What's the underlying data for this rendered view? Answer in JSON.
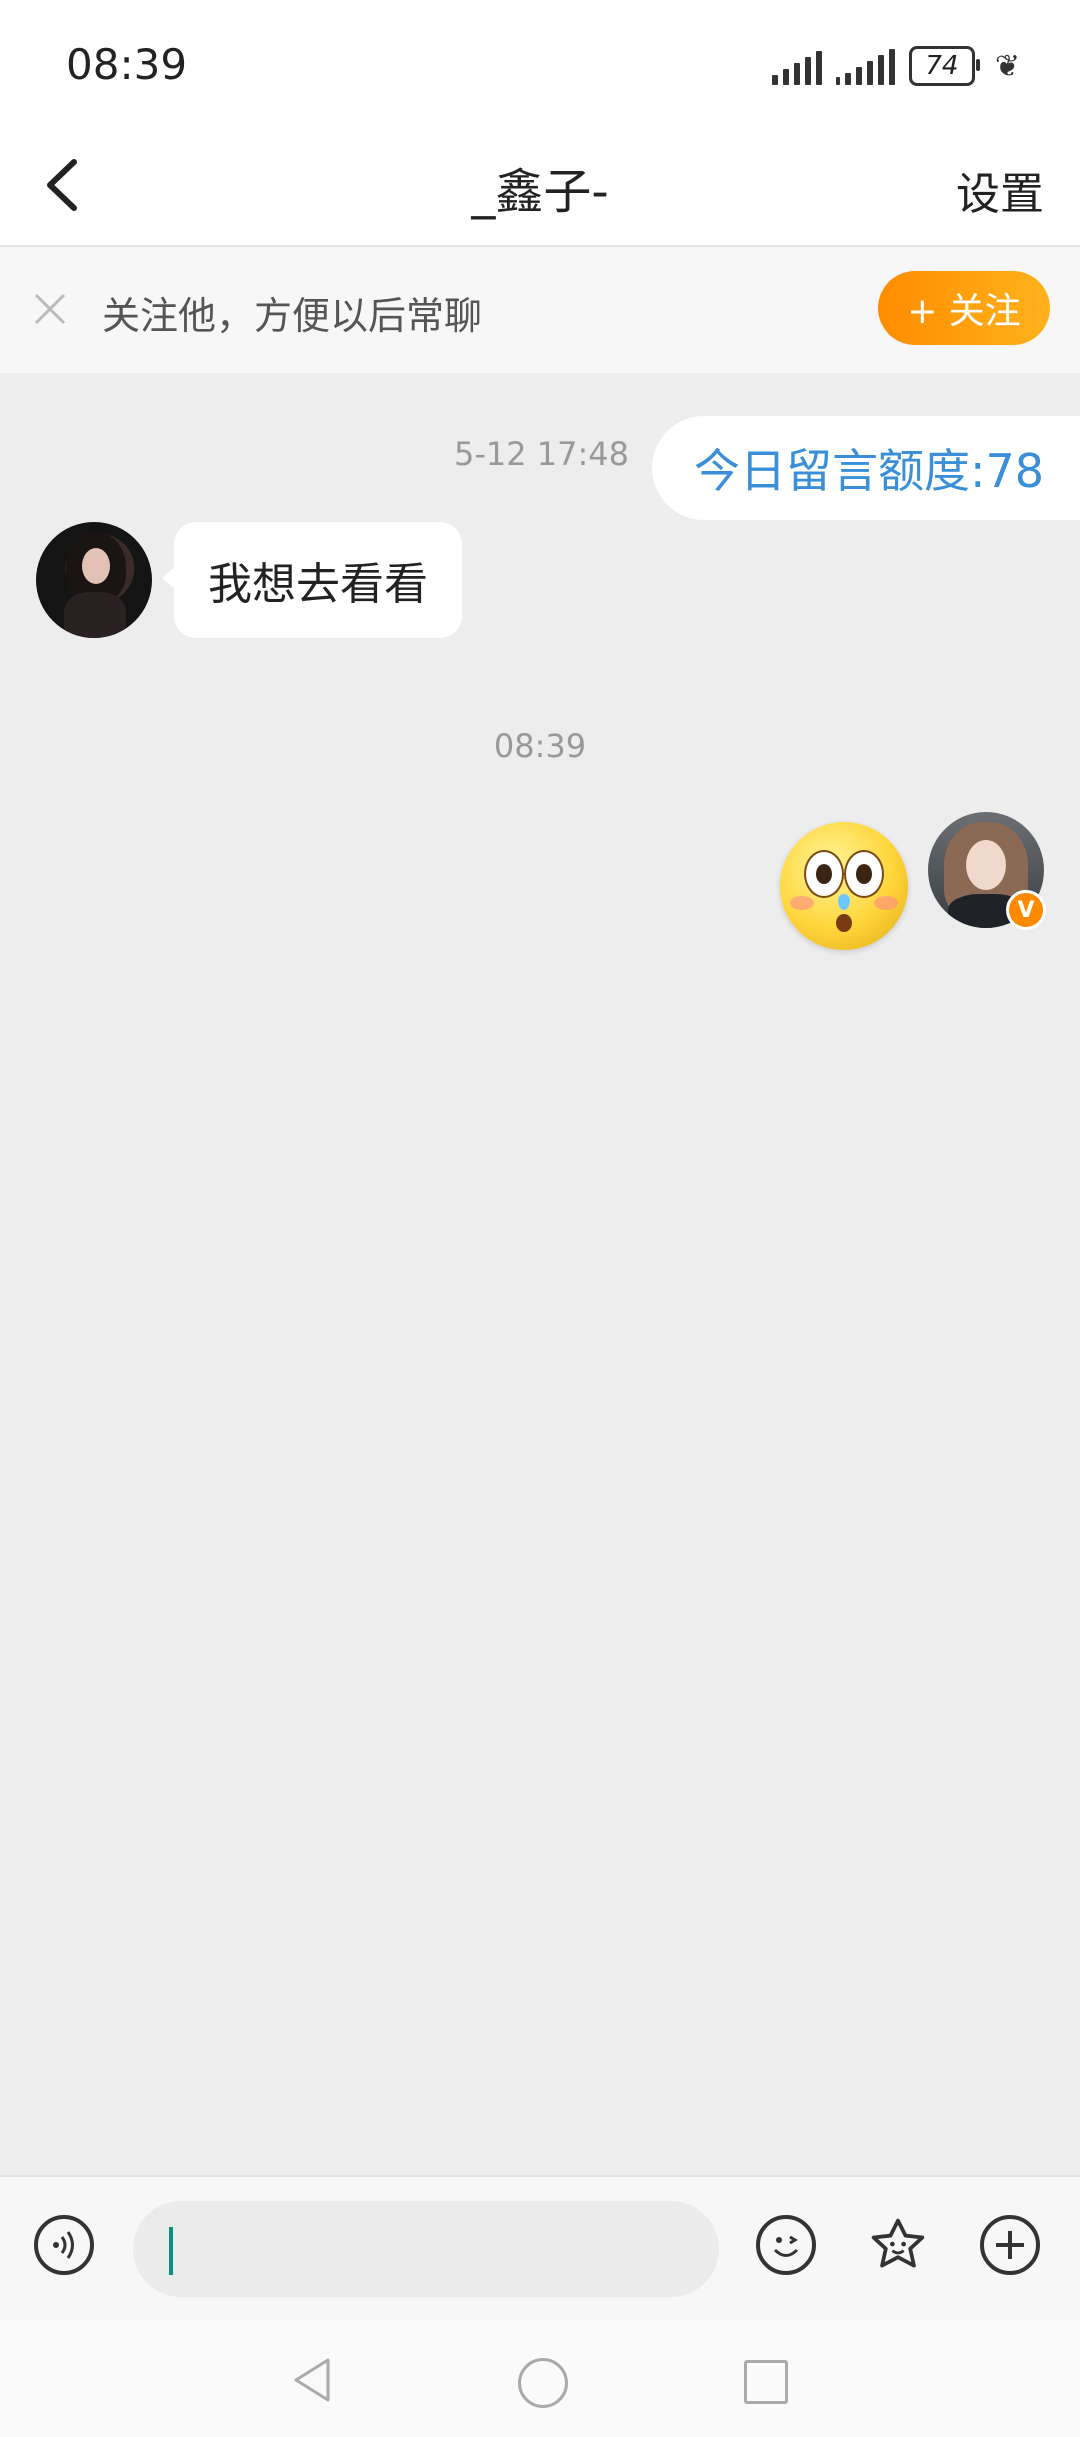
{
  "status_bar": {
    "time": "08:39",
    "battery": "74"
  },
  "header": {
    "title": "_鑫子-",
    "settings_label": "设置"
  },
  "follow_banner": {
    "text": "关注他，方便以后常聊",
    "button_label": "+ 关注"
  },
  "messages": {
    "timestamp_1": "5-12 17:48",
    "quota_text": "今日留言额度:78",
    "incoming_text": "我想去看看",
    "timestamp_2": "08:39",
    "badge_label": "V"
  },
  "composer": {
    "placeholder": ""
  },
  "colors": {
    "accent_orange": "#ff8c00",
    "link_blue": "#3a8fd8",
    "chat_background": "#ededed"
  },
  "icons": [
    "back-icon",
    "close-icon",
    "voice-icon",
    "emoji-icon",
    "sticker-icon",
    "plus-icon",
    "nav-back-icon",
    "nav-home-icon",
    "nav-recent-icon"
  ]
}
